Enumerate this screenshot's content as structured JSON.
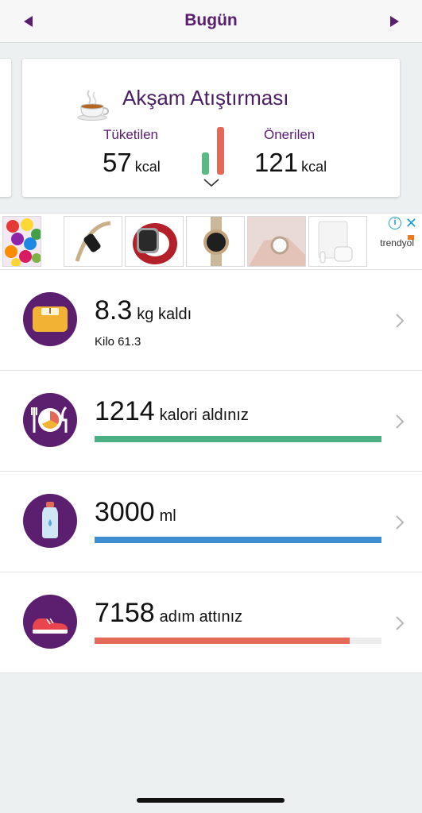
{
  "header": {
    "title": "Bugün"
  },
  "meal": {
    "title": "Akşam Atıştırması",
    "consumed_label": "Tüketilen",
    "consumed_value": "57",
    "consumed_unit": "kcal",
    "recommended_label": "Önerilen",
    "recommended_value": "121",
    "recommended_unit": "kcal",
    "consumed_fraction": 0.47
  },
  "ad": {
    "brand": "trendyol",
    "info_glyph": "i",
    "close_glyph": "✕"
  },
  "stats": [
    {
      "value": "8.3",
      "label": "kg kaldı",
      "sub": "Kilo 61.3",
      "icon": "scale-icon"
    },
    {
      "value": "1214",
      "label": "kalori aldınız",
      "progress": 1.0,
      "color": "#4caf84",
      "icon": "plate-icon"
    },
    {
      "value": "3000",
      "label": "ml",
      "progress": 1.0,
      "color": "#3f8fd0",
      "icon": "water-bottle-icon"
    },
    {
      "value": "7158",
      "label": "adım attınız",
      "progress": 0.89,
      "color": "#e36a58",
      "icon": "sneaker-icon"
    }
  ],
  "colors": {
    "brand_purple": "#5c1e6e",
    "background": "#ecf0f1"
  }
}
